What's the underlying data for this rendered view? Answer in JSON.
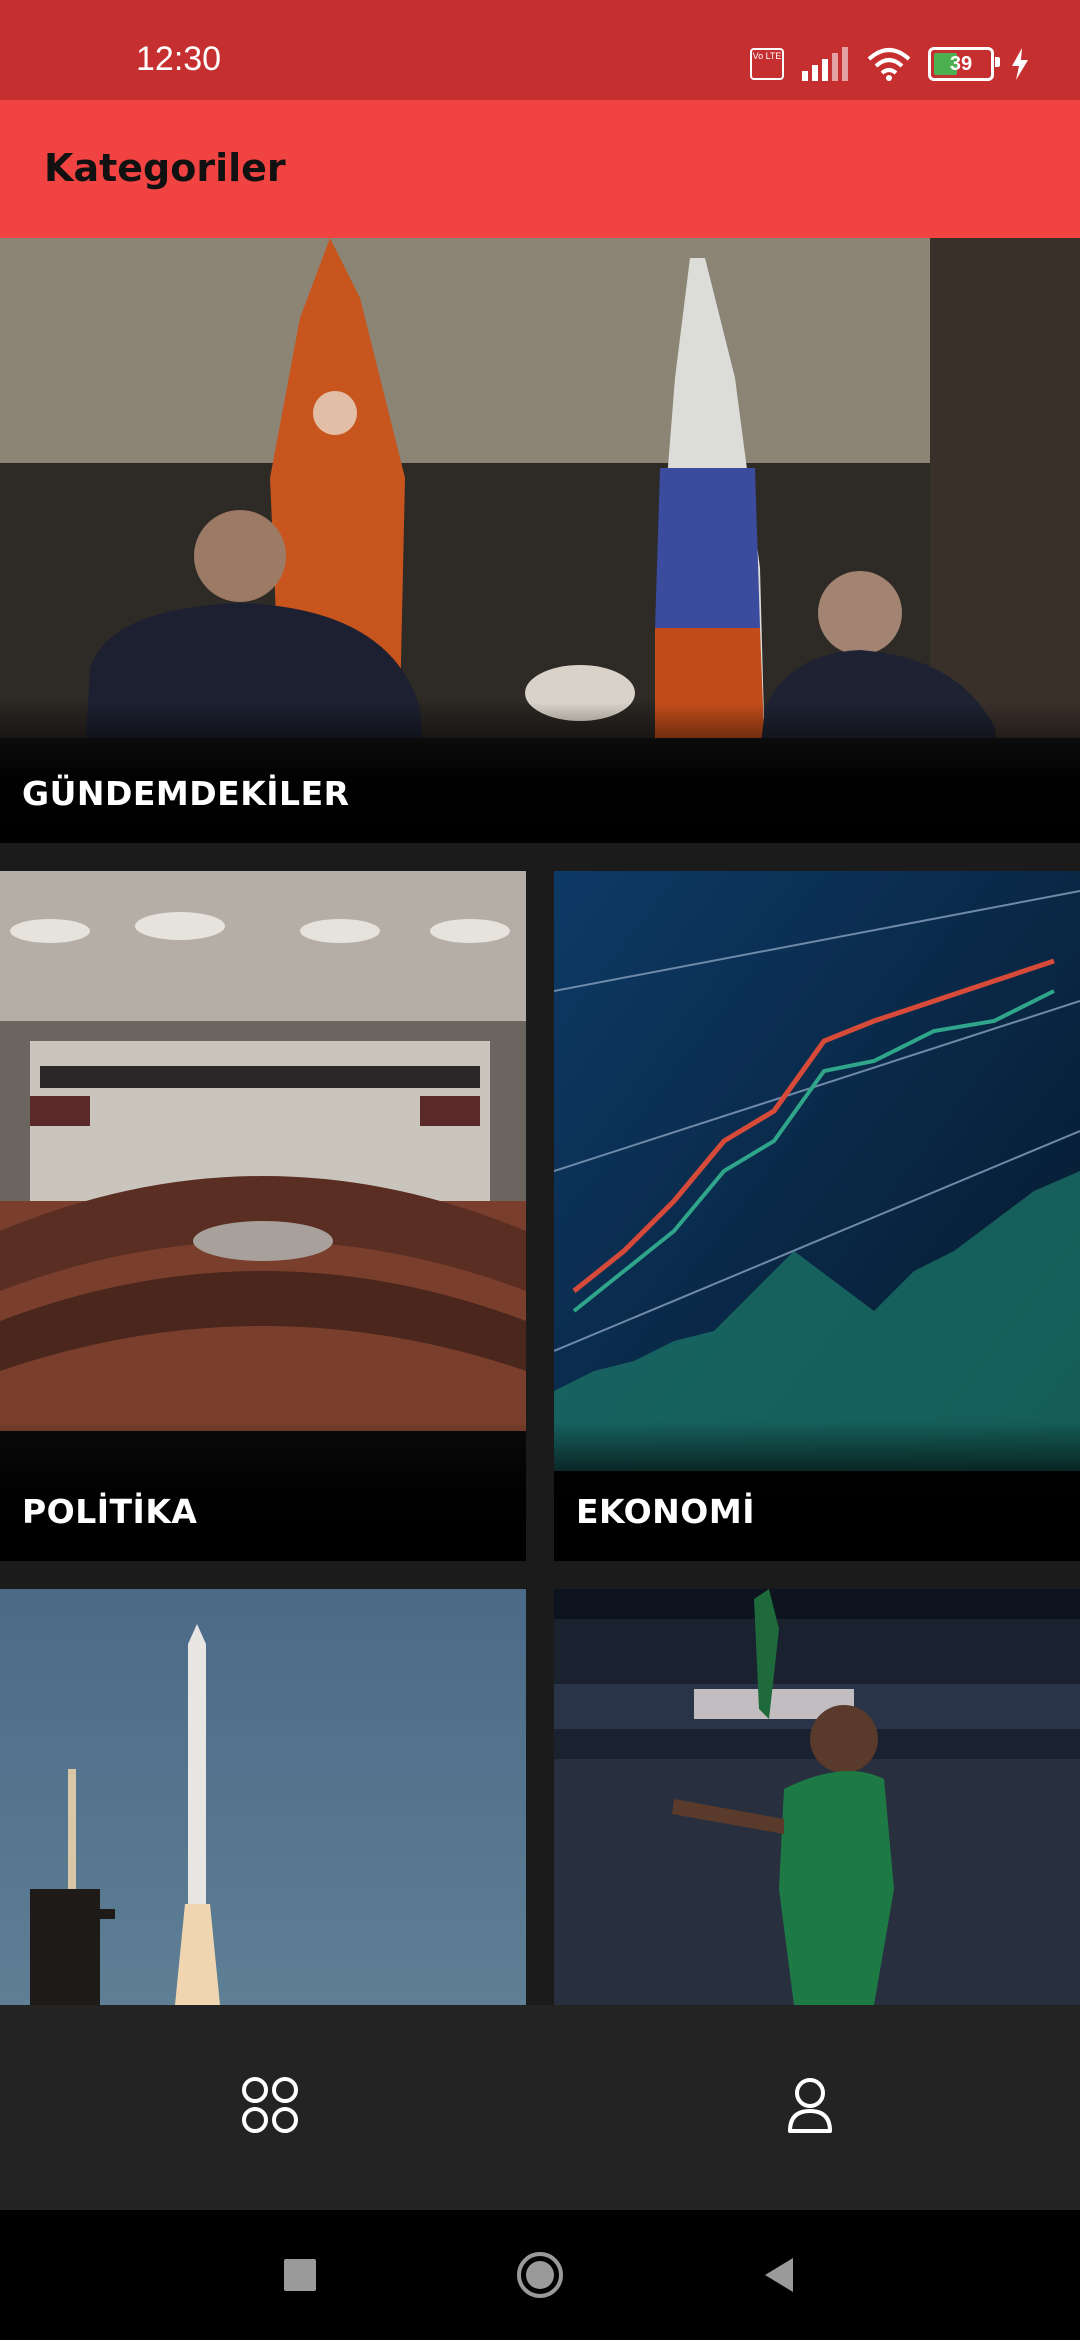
{
  "status_bar": {
    "time": "12:30",
    "volte_label": "Vo LTE",
    "battery_level": "39",
    "icons": [
      "volte-icon",
      "signal-icon",
      "wifi-icon",
      "battery-icon",
      "charging-icon"
    ]
  },
  "app_bar": {
    "title": "Kategoriler"
  },
  "categories": [
    {
      "label": "GÜNDEMDEKİLER"
    },
    {
      "label": "POLİTİKA"
    },
    {
      "label": "EKONOMİ"
    },
    {
      "label": ""
    },
    {
      "label": ""
    }
  ],
  "bottom_nav": {
    "items": [
      {
        "icon": "grid-icon",
        "selected": true
      },
      {
        "icon": "profile-icon",
        "selected": false
      }
    ]
  },
  "system_nav": {
    "items": [
      "recents-icon",
      "home-icon",
      "back-icon"
    ]
  },
  "colors": {
    "status_bar": "#c62f30",
    "app_bar": "#f24343",
    "background": "#1b1b1b",
    "bottom_nav": "#232323"
  }
}
